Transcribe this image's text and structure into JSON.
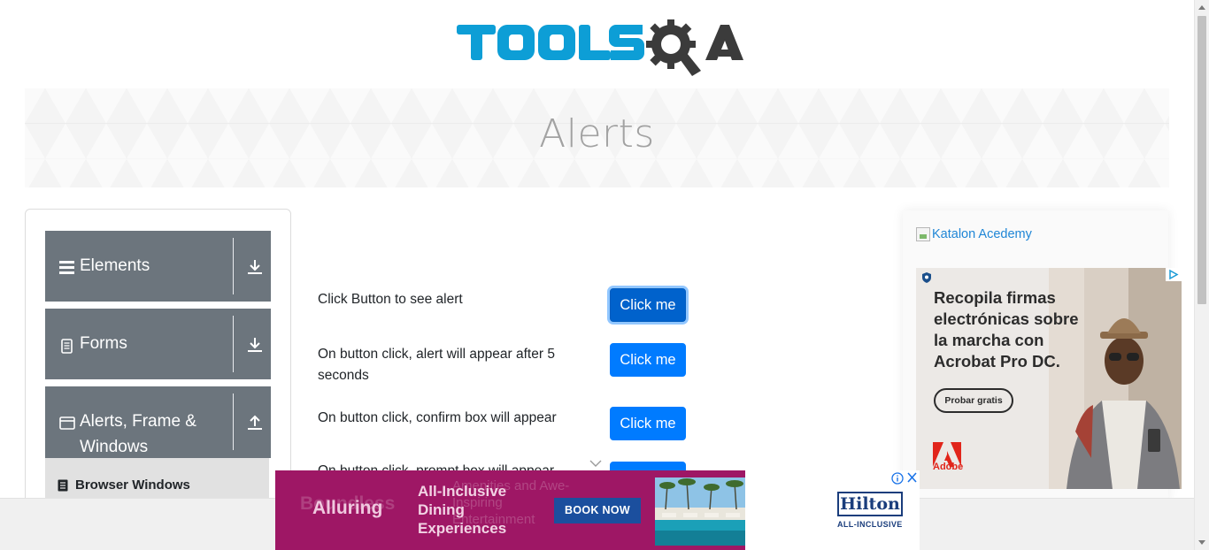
{
  "page": {
    "title": "Alerts",
    "logo_text": "TOOLSQA"
  },
  "sidebar": {
    "groups": [
      {
        "label": "Elements",
        "icon": "hamburger-icon",
        "arrow": "download-arrow-icon"
      },
      {
        "label": "Forms",
        "icon": "document-icon",
        "arrow": "download-arrow-icon"
      },
      {
        "label": "Alerts, Frame &",
        "label_line2": "Windows",
        "icon": "window-icon",
        "arrow": "upload-arrow-icon"
      }
    ],
    "sub_items": [
      {
        "label": "Browser Windows",
        "icon": "list-icon"
      }
    ]
  },
  "main": {
    "rows": [
      {
        "label": "Click Button to see alert",
        "button": "Click me",
        "focused": true
      },
      {
        "label": "On button click, alert will appear after 5 seconds",
        "button": "Click me",
        "focused": false
      },
      {
        "label": "On button click, confirm box will appear",
        "button": "Click me",
        "focused": false
      },
      {
        "label": "On button click, prompt box will appear",
        "button": "Click me",
        "focused": false
      }
    ]
  },
  "right_ad": {
    "link_alt": "Katalon Acedemy",
    "headline": "Recopila firmas electrónicas sobre la marcha con Acrobat Pro DC.",
    "cta": "Probar gratis",
    "brand": "Adobe"
  },
  "bottom_ad": {
    "ghost_left": "Boundless",
    "ghost_right": "Amenities and Awe-Inspiring Entertainment",
    "tag_left": "Alluring",
    "tag_right": "All-Inclusive Dining Experiences",
    "button": "BOOK NOW",
    "brand": "Hilton",
    "brand_sub": "ALL-INCLUSIVE"
  },
  "colors": {
    "primary": "#007bff",
    "sidebar_group": "#6c757d",
    "logo_blue": "#0d9ed6",
    "logo_dark": "#3b3b3b",
    "hilton_magenta": "#9e1765"
  }
}
